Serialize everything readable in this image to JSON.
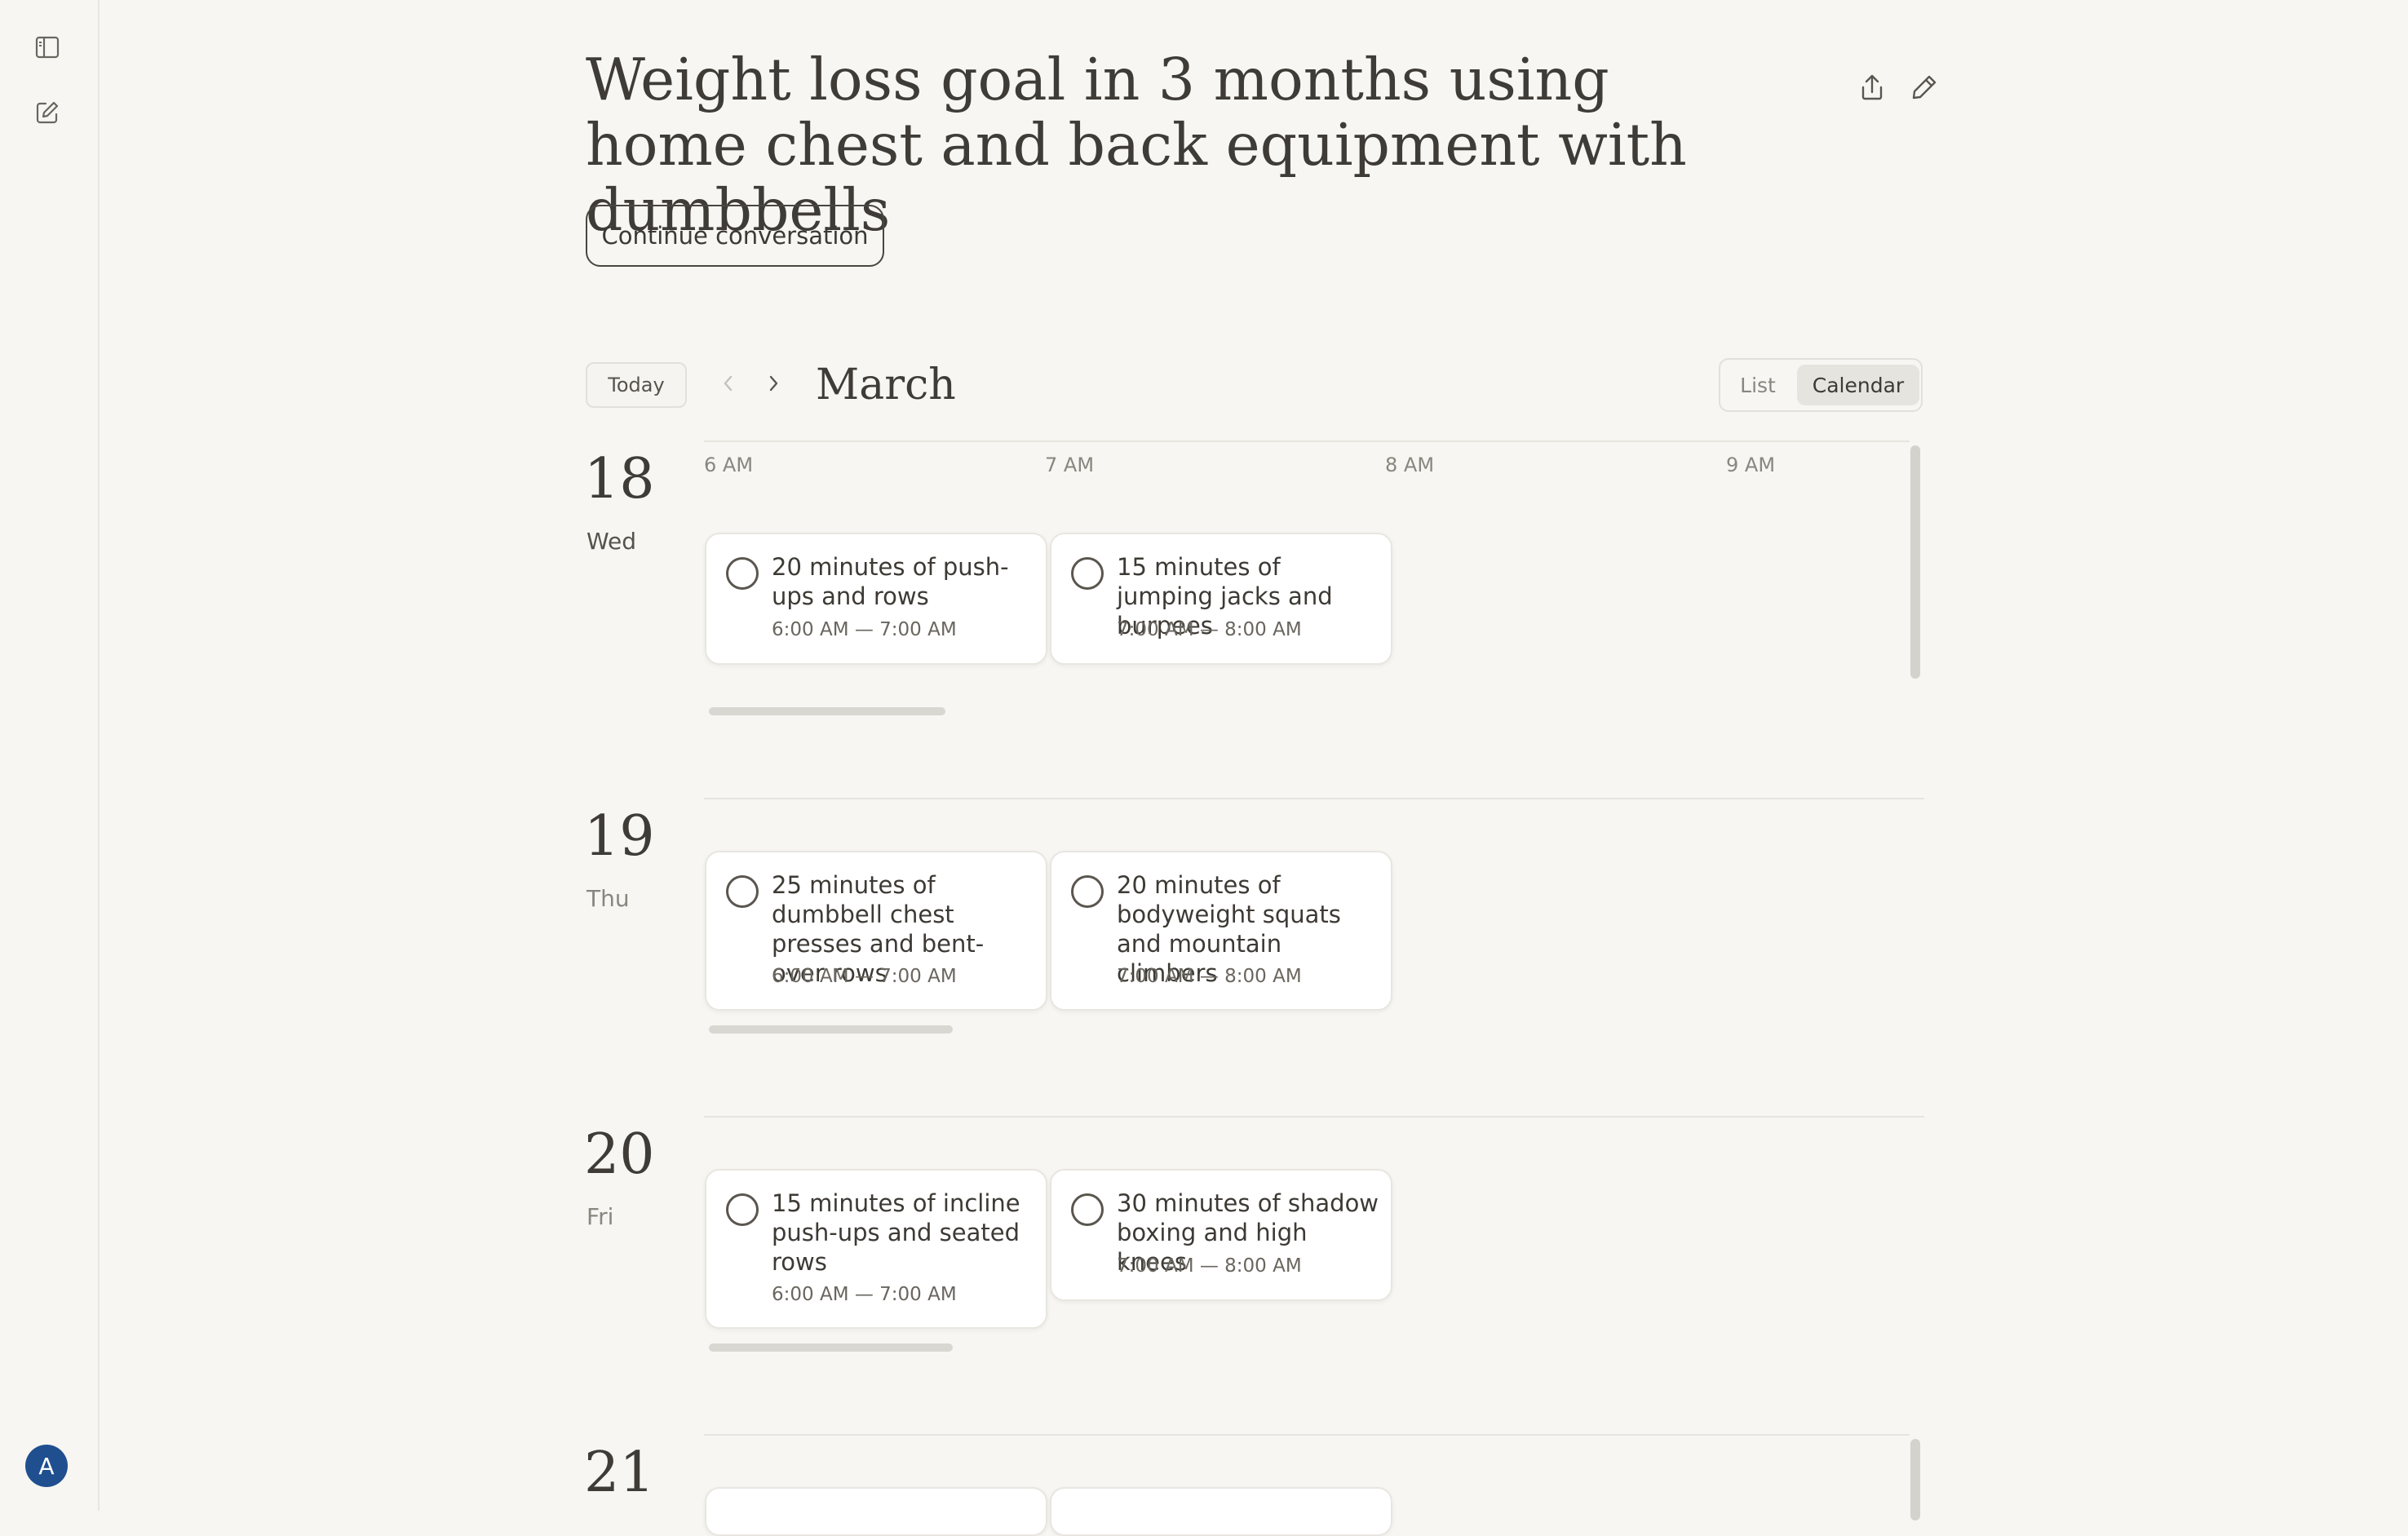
{
  "sidebar": {
    "toggle_icon": "sidebar-icon",
    "compose_icon": "compose-icon",
    "avatar_letter": "A"
  },
  "header": {
    "title": "Weight loss goal in 3 months using home chest and back equipment with dumbbells",
    "continue_label": "Continue conversation",
    "share_icon": "share-icon",
    "edit_icon": "pencil-icon"
  },
  "calendar": {
    "today_label": "Today",
    "month": "March",
    "view_list": "List",
    "view_calendar": "Calendar",
    "active_view": "Calendar",
    "hours": [
      "6 AM",
      "7 AM",
      "8 AM",
      "9 AM"
    ],
    "days": [
      {
        "num": "18",
        "name": "Wed",
        "events": [
          {
            "title": "20 minutes of push-ups and rows",
            "time": "6:00 AM — 7:00 AM"
          },
          {
            "title": "15 minutes of jumping jacks and burpees",
            "time": "7:00 AM — 8:00 AM"
          }
        ]
      },
      {
        "num": "19",
        "name": "Thu",
        "events": [
          {
            "title": "25 minutes of dumbbell chest presses and bent-over rows",
            "time": "6:00 AM — 7:00 AM"
          },
          {
            "title": "20 minutes of bodyweight squats and mountain climbers",
            "time": "7:00 AM — 8:00 AM"
          }
        ]
      },
      {
        "num": "20",
        "name": "Fri",
        "events": [
          {
            "title": "15 minutes of incline push-ups and seated rows",
            "time": "6:00 AM — 7:00 AM"
          },
          {
            "title": "30 minutes of shadow boxing and high knees",
            "time": "7:00 AM — 8:00 AM"
          }
        ]
      },
      {
        "num": "21"
      }
    ]
  }
}
